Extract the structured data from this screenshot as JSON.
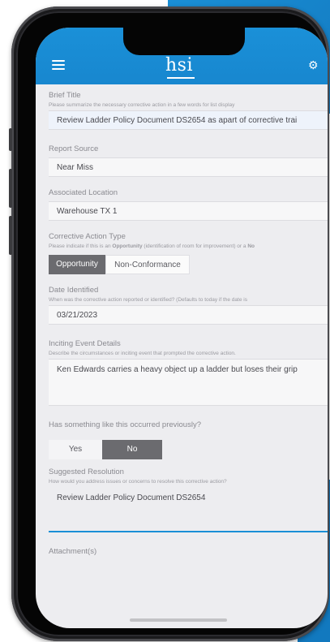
{
  "colors": {
    "brand_blue": "#1a8fd6",
    "segment_active": "#6b6b6f",
    "screen_bg": "#ededf0"
  },
  "header": {
    "logo_text": "hsi",
    "menu_icon": "hamburger-menu-icon",
    "settings_icon": "gear-icon"
  },
  "form": {
    "brief_title": {
      "label": "Brief Title",
      "help": "Please summarize the necessary corrective action in a few words for list display",
      "value": "Review Ladder Policy Document DS2654 as apart of corrective trai"
    },
    "report_source": {
      "label": "Report Source",
      "value": "Near Miss"
    },
    "associated_location": {
      "label": "Associated Location",
      "value": "Warehouse TX 1"
    },
    "corrective_action_type": {
      "label": "Corrective Action Type",
      "help_prefix": "Please indicate if this is an ",
      "help_bold": "Opportunity",
      "help_suffix": " (identification of room for improvement) or a ",
      "help_bold2": "No",
      "options": [
        "Opportunity",
        "Non-Conformance"
      ],
      "selected": "Opportunity"
    },
    "date_identified": {
      "label": "Date Identified",
      "help": "When was the corrective action reported or identified? (Defaults to today if the date is",
      "value": "03/21/2023"
    },
    "inciting_event": {
      "label": "Inciting Event Details",
      "help": "Describe the circumstances or inciting event that prompted the corrective action.",
      "value": "Ken Edwards carries a heavy object up a ladder but loses their grip"
    },
    "occurred_previously": {
      "label": "Has something like this occurred previously?",
      "options": [
        "Yes",
        "No"
      ],
      "selected": "No"
    },
    "suggested_resolution": {
      "label": "Suggested Resolution",
      "help": "How would you address issues or concerns to resolve this corrective action?",
      "value": "Review Ladder Policy Document DS2654"
    },
    "attachments": {
      "label": "Attachment(s)"
    }
  }
}
